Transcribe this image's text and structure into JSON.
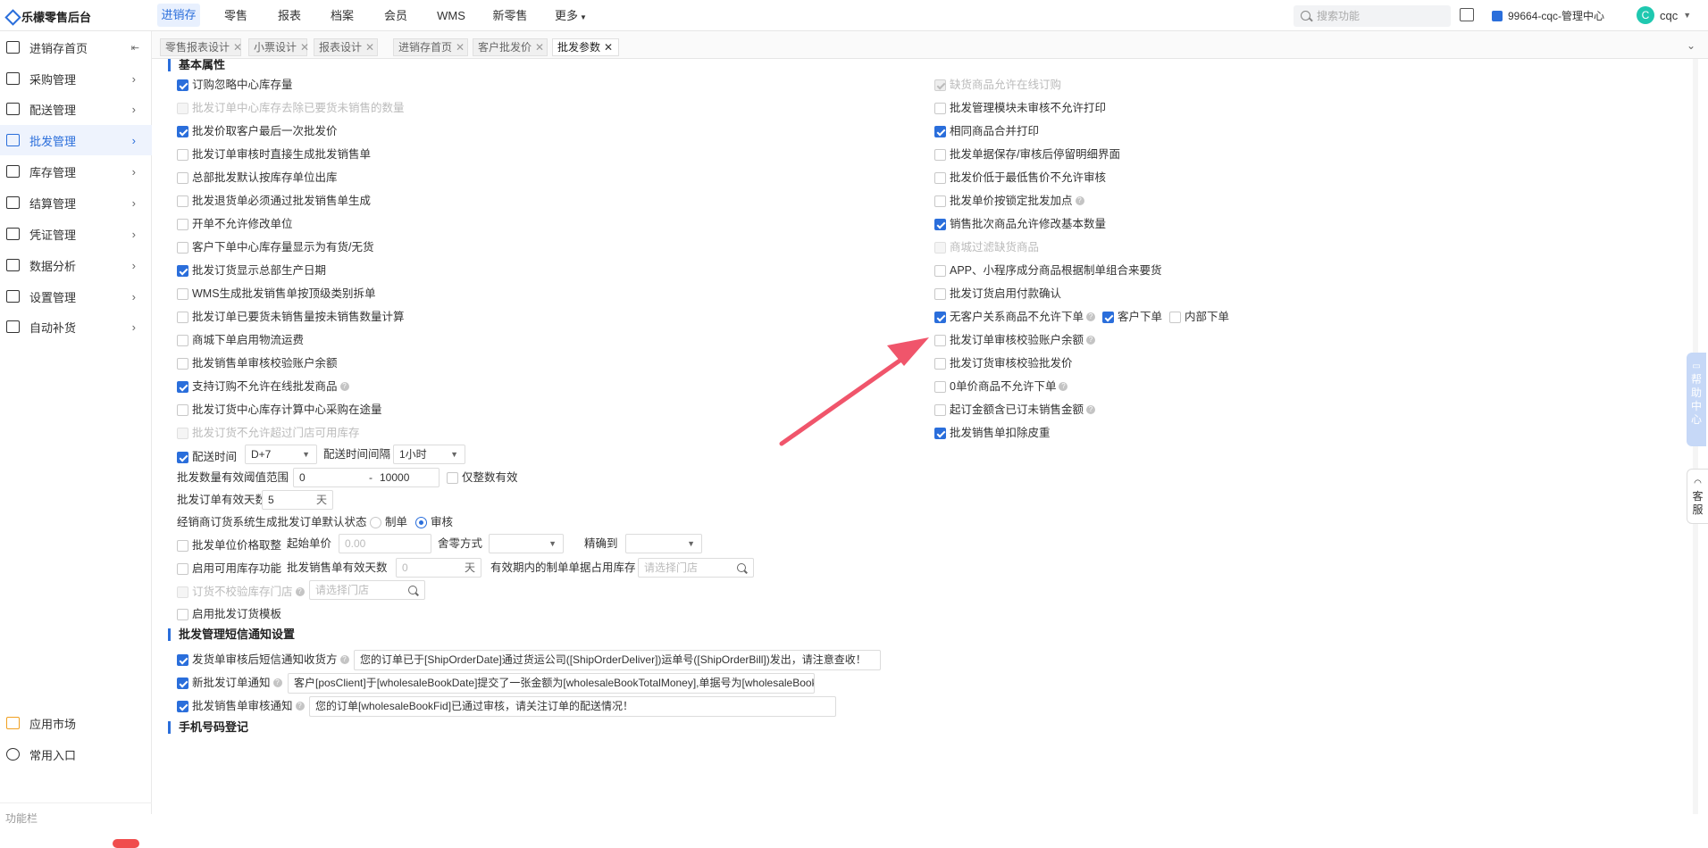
{
  "app": {
    "title": "乐檬零售后台"
  },
  "topnav": [
    "进销存",
    "零售",
    "报表",
    "档案",
    "会员",
    "WMS",
    "新零售",
    "更多"
  ],
  "search": {
    "placeholder": "搜索功能"
  },
  "store": "99664-cqc-管理中心",
  "user": {
    "initial": "C",
    "name": "cqc"
  },
  "sidebar": {
    "items": [
      "进销存首页",
      "采购管理",
      "配送管理",
      "批发管理",
      "库存管理",
      "结算管理",
      "凭证管理",
      "数据分析",
      "设置管理",
      "自动补货"
    ],
    "bottom": [
      "应用市场",
      "常用入口"
    ],
    "footer_label": "功能栏"
  },
  "tabs": [
    "零售报表设计",
    "小票设计",
    "报表设计",
    "进销存首页",
    "客户批发价",
    "批发参数"
  ],
  "sections": {
    "basic": "基本属性",
    "sms": "批发管理短信通知设置",
    "phone": "手机号码登记"
  },
  "left_options": [
    "订购忽略中心库存量",
    "批发订单中心库存去除已要货未销售的数量",
    "批发价取客户最后一次批发价",
    "批发订单审核时直接生成批发销售单",
    "总部批发默认按库存单位出库",
    "批发退货单必须通过批发销售单生成",
    "开单不允许修改单位",
    "客户下单中心库存量显示为有货/无货",
    "批发订货显示总部生产日期",
    "WMS生成批发销售单按顶级类别拆单",
    "批发订单已要货未销售量按未销售数量计算",
    "商城下单启用物流运费",
    "批发销售单审核校验账户余额",
    "支持订购不允许在线批发商品",
    "批发订货中心库存计算中心采购在途量",
    "批发订货不允许超过门店可用库存"
  ],
  "right_options": [
    "缺货商品允许在线订购",
    "批发管理模块未审核不允许打印",
    "相同商品合并打印",
    "批发单据保存/审核后停留明细界面",
    "批发价低于最低售价不允许审核",
    "批发单价按锁定批发加点",
    "销售批次商品允许修改基本数量",
    "商城过滤缺货商品",
    "APP、小程序成分商品根据制单组合来要货",
    "批发订货启用付款确认",
    "无客户关系商品不允许下单",
    "批发订单审核校验账户余额",
    "批发订货审核校验批发价",
    "0单价商品不允许下单",
    "起订金额含已订未销售金额",
    "批发销售单扣除皮重"
  ],
  "extra_opts": {
    "customer_order": "客户下单",
    "internal_order": "内部下单"
  },
  "form": {
    "delivery_time_label": "配送时间",
    "delivery_time_value": "D+7",
    "interval_label": "配送时间间隔",
    "interval_value": "1小时",
    "qty_range_label": "批发数量有效阈值范围",
    "qty_min": "0",
    "qty_sep": "-",
    "qty_max": "10000",
    "integer_only": "仅整数有效",
    "valid_days_label": "批发订单有效天数",
    "valid_days_value": "5",
    "day_unit": "天",
    "default_status_label": "经销商订货系统生成批发订单默认状态",
    "status_draft": "制单",
    "status_audit": "审核",
    "price_round_label": "批发单位价格取整",
    "start_price_label": "起始单价",
    "start_price_placeholder": "0.00",
    "round_mode_label": "舍零方式",
    "precision_label": "精确到",
    "stock_func_label": "启用可用库存功能",
    "sale_valid_days_label": "批发销售单有效天数",
    "sale_valid_days_placeholder": "0",
    "occupy_label": "有效期内的制单单据占用库存",
    "store_placeholder": "请选择门店",
    "no_check_store_label": "订货不校验库存门店",
    "template_label": "启用批发订货模板"
  },
  "sms": [
    {
      "label": "发货单审核后短信通知收货方",
      "text": "您的订单已于[ShipOrderDate]通过货运公司([ShipOrderDeliver])运单号([ShipOrderBill])发出，请注意查收！"
    },
    {
      "label": "新批发订单通知",
      "text": "客户[posClient]于[wholesaleBookDate]提交了一张金额为[wholesaleBookTotalMoney],单据号为[wholesaleBookFid]的批发订单"
    },
    {
      "label": "批发销售单审核通知",
      "text": "您的订单[wholesaleBookFid]已通过审核，请关注订单的配送情况！"
    }
  ],
  "side_tabs": {
    "help": [
      "帮",
      "助",
      "中",
      "心"
    ],
    "service": [
      "客",
      "服"
    ]
  },
  "colors": {
    "accent": "#2a6edb",
    "arrow": "#f0556b"
  }
}
